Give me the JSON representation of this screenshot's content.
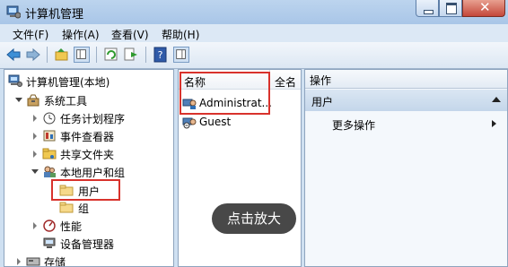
{
  "window": {
    "title": "计算机管理"
  },
  "menu": [
    "文件(F)",
    "操作(A)",
    "查看(V)",
    "帮助(H)"
  ],
  "tree": {
    "root": "计算机管理(本地)",
    "system_tools": "系统工具",
    "task_scheduler": "任务计划程序",
    "event_viewer": "事件查看器",
    "shared_folders": "共享文件夹",
    "local_users_groups": "本地用户和组",
    "users": "用户",
    "groups": "组",
    "performance": "性能",
    "device_manager": "设备管理器",
    "storage": "存储"
  },
  "list": {
    "col_name": "名称",
    "col_fullname": "全名",
    "rows": [
      "Administrat...",
      "Guest"
    ]
  },
  "actions": {
    "header": "操作",
    "section": "用户",
    "more": "更多操作"
  },
  "overlay": {
    "zoom_hint": "点击放大"
  },
  "colors": {
    "highlight_border": "#d8322c",
    "accent": "#3a6ea5"
  }
}
